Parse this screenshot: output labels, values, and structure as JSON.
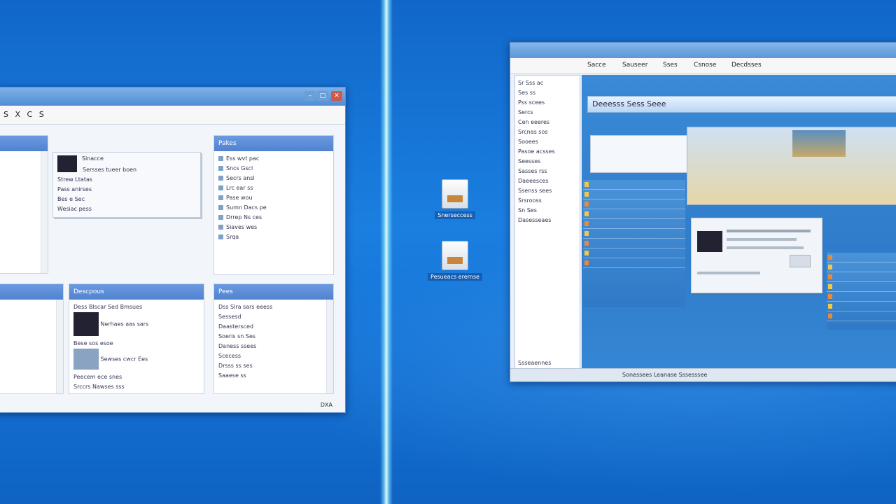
{
  "left_window": {
    "title": "",
    "menu": "S X C S",
    "status": "DXA",
    "panel_a": {
      "heading": "",
      "rows": [
        "",
        "",
        "",
        "",
        "",
        ""
      ]
    },
    "panel_b": {
      "heading": "Pakes",
      "rows": [
        "Ess wvt pac",
        "Sncs Gscl",
        "Secrs ansl",
        "Lrc ear ss",
        "Pase wou",
        "Sumn Dacs pe",
        "Drrep Ns ces",
        "Siaves wes",
        "Srqa"
      ]
    },
    "card_a": {
      "title": "Sinacce",
      "line1": "Sersses tueer boen",
      "line2": "Strew Ltatas",
      "line3": "Pass anirses",
      "line4": "Bes e Sec",
      "line5": "Wesiac pess"
    },
    "panel_c": {
      "heading": "Descpous",
      "rows": [
        "Dess Blscar Sed Bmsues",
        "Nerhaes aas sars",
        "Bese sos esoe",
        "Sewses cwcr Ees",
        "Peecem ece snes",
        "Srccrs Nawses sss"
      ]
    },
    "panel_d": {
      "heading": "Pees",
      "rows": [
        "Dss Slra sars eeess",
        "Sessesd",
        "Daastersced",
        "Soeris sn Ses",
        "Daness ssees",
        "Scecess",
        "Drsss ss ses",
        "Saaese ss"
      ]
    },
    "panel_e": {
      "heading": "",
      "rows": [
        "",
        "",
        "",
        "",
        "",
        "",
        ""
      ]
    }
  },
  "desktop_icons": [
    {
      "label": "Snerseccess"
    },
    {
      "label": "Pesueacs erernse"
    }
  ],
  "right_window": {
    "title": "",
    "menu": [
      "Sacce",
      "Sauseer",
      "Sses",
      "Csnose",
      "Decdsses"
    ],
    "tree": [
      "Sr Sss ac",
      "Ses ss",
      "Pss scees",
      "Sercs",
      "Cen eeeres",
      "Srcnas sos",
      "Sooees",
      "Pasoe acsses",
      "Seesses",
      "Sasses rss",
      "Daeeesces",
      "Ssenss sees",
      "Srsrooss",
      "Sn Ses",
      "Dasesseaes"
    ],
    "tree_status": "Ssseaennes",
    "banner": "Deeesss Sess Seee",
    "status_text": "Sonessees Leanase Sssesssee"
  }
}
